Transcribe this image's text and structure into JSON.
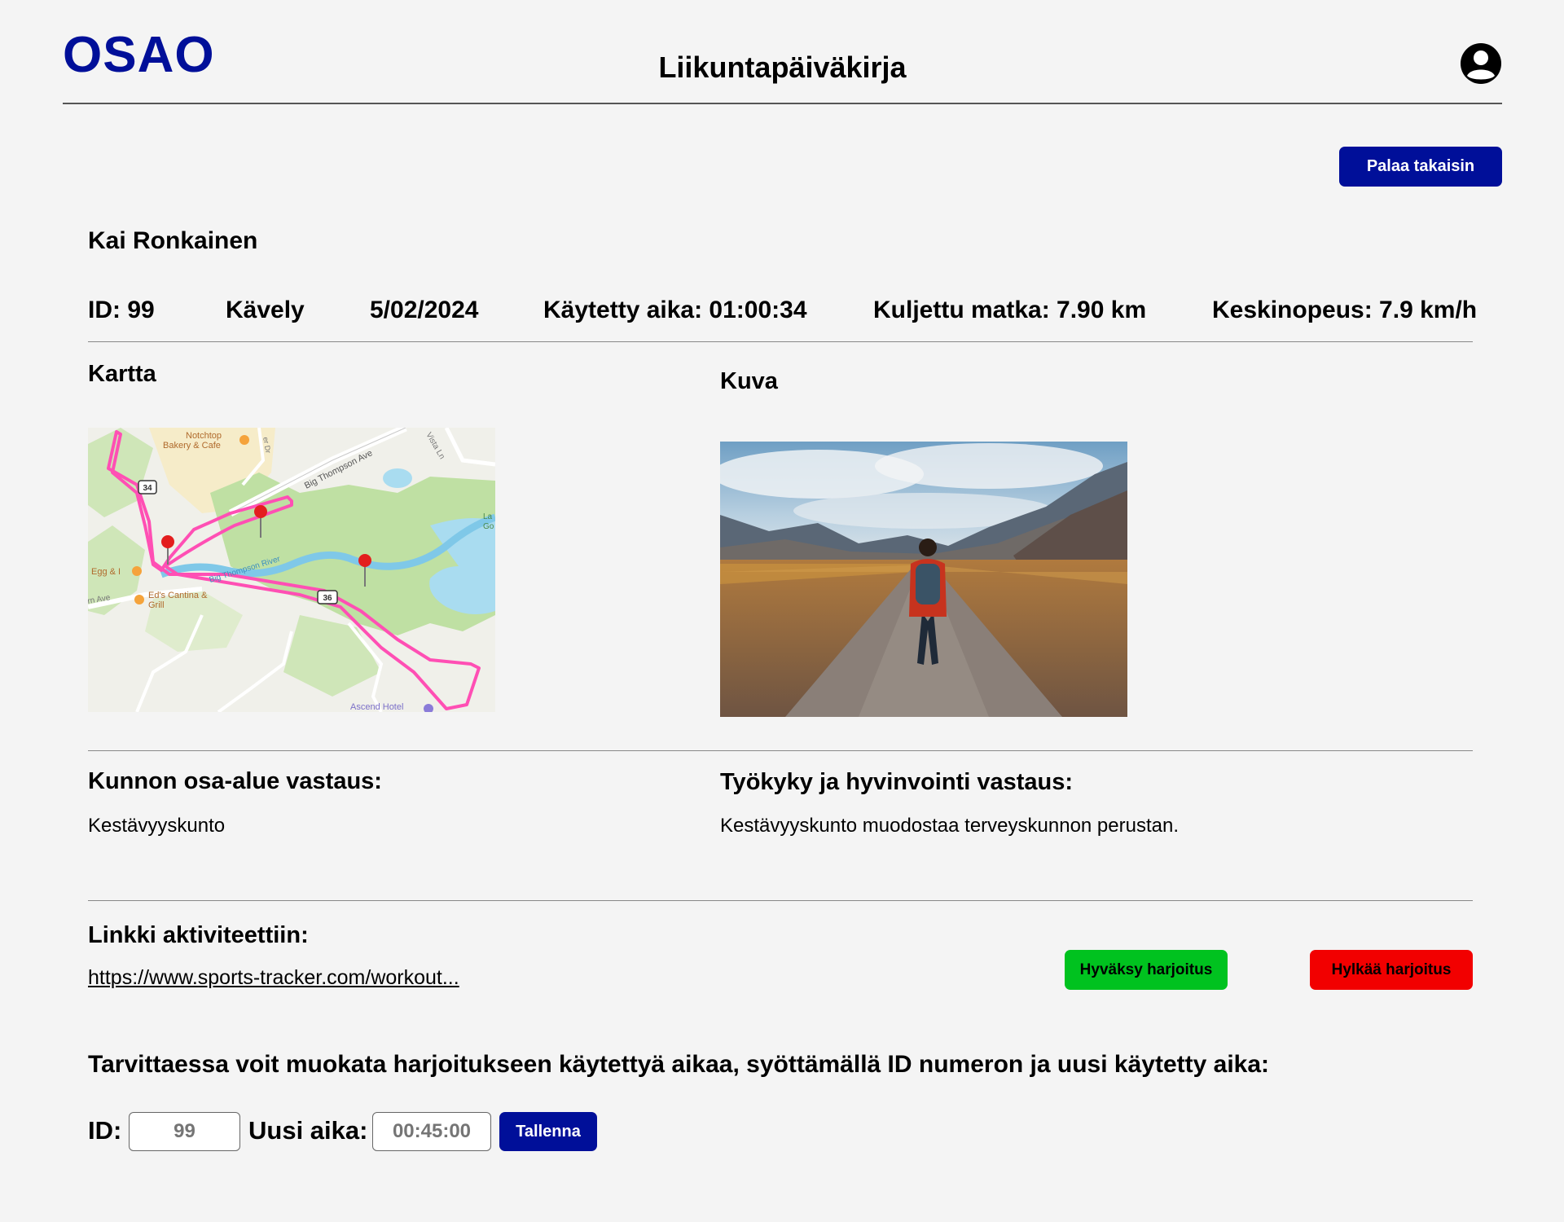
{
  "header": {
    "logo": "OSAO",
    "title": "Liikuntapäiväkirja"
  },
  "actions": {
    "back_label": "Palaa takaisin",
    "approve_label": "Hyväksy harjoitus",
    "reject_label": "Hylkää harjoitus"
  },
  "workout": {
    "person": "Kai Ronkainen",
    "id": "ID: 99",
    "activity": "Kävely",
    "date": "5/02/2024",
    "time_used": "Käytetty aika: 01:00:34",
    "distance": "Kuljettu matka: 7.90 km",
    "avg_speed": "Keskinopeus: 7.9 km/h"
  },
  "map_section": {
    "heading": "Kartta",
    "labels": {
      "bakery_line1": "Notchtop",
      "bakery_line2": "Bakery & Cafe",
      "road1": "Big Thompson Ave",
      "road2": "Vista Ln",
      "river": "Big Thompson River",
      "egg": "Egg & I",
      "cantina_line1": "Ed's Cantina &",
      "cantina_line2": "Grill",
      "hotel": "Ascend Hotel",
      "hwy34": "34",
      "hwy36": "36",
      "ave_frag": "rn Ave",
      "dr_frag": "er Dr",
      "lake_frag1": "La",
      "lake_frag2": "Go"
    }
  },
  "photo_section": {
    "heading": "Kuva"
  },
  "answers": {
    "fitness_heading": "Kunnon osa-alue vastaus:",
    "fitness_value": "Kestävyyskunto",
    "wellbeing_heading": "Työkyky ja hyvinvointi vastaus:",
    "wellbeing_value": "Kestävyyskunto muodostaa terveyskunnon perustan."
  },
  "link_section": {
    "heading": "Linkki aktiviteettiin:",
    "url": "https://www.sports-tracker.com/workout..."
  },
  "edit_form": {
    "instructions": "Tarvittaessa voit muokata harjoitukseen käytettyä aikaa, syöttämällä ID numeron ja uusi käytetty aika:",
    "id_label": "ID:",
    "id_placeholder": "99",
    "time_label": "Uusi aika:",
    "time_placeholder": "00:45:00",
    "save_label": "Tallenna"
  },
  "colors": {
    "brand": "#000f99",
    "approve": "#00c21f",
    "reject": "#f20000",
    "route": "#ff4fb4"
  },
  "icons": [
    "user-account-icon",
    "map-pin-icon",
    "restaurant-icon"
  ]
}
